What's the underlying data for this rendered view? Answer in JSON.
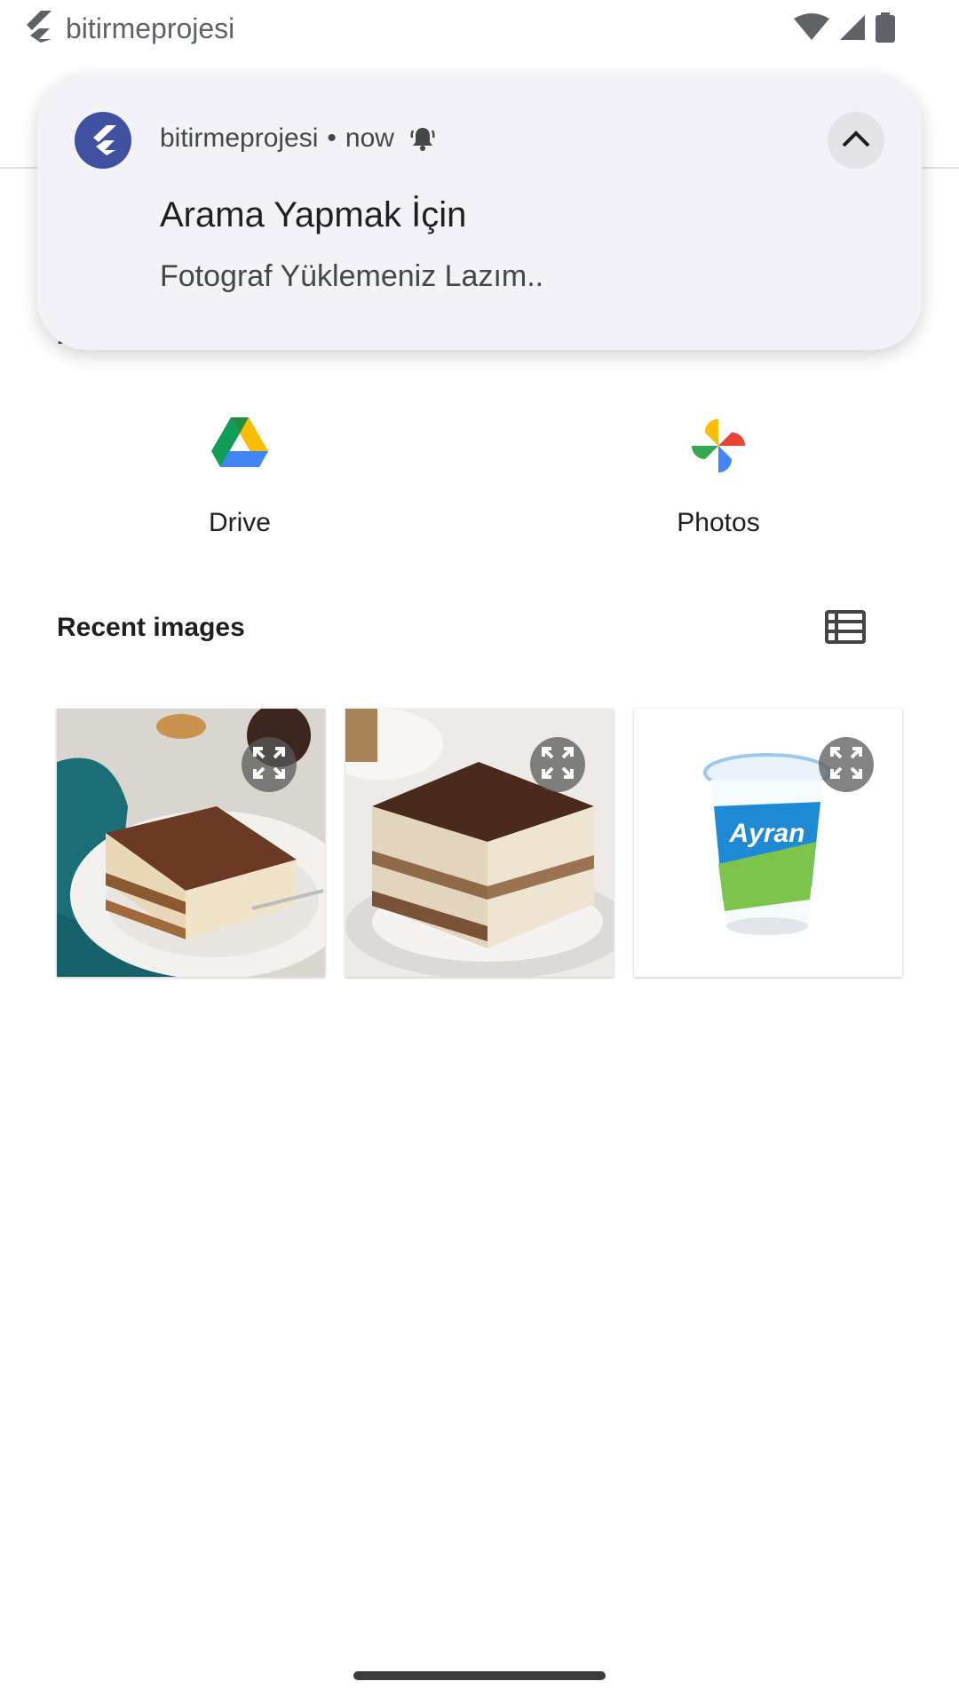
{
  "status_bar": {
    "app_name": "bitirmeprojesi"
  },
  "notification": {
    "app_name": "bitirmeprojesi",
    "separator": "•",
    "time": "now",
    "title": "Arama Yapmak İçin",
    "body": "Fotograf Yüklemeniz Lazım.."
  },
  "partial_heading": "B",
  "providers": [
    {
      "label": "Drive",
      "icon": "google-drive-icon"
    },
    {
      "label": "Photos",
      "icon": "google-photos-icon"
    }
  ],
  "recent": {
    "title": "Recent images",
    "images": [
      {
        "name": "tiramisu-photo-1"
      },
      {
        "name": "tiramisu-photo-2"
      },
      {
        "name": "ayran-cup-photo",
        "brand_text": "Ayran"
      }
    ]
  },
  "colors": {
    "accent": "#3f51a0",
    "notification_bg": "#f2f2f8"
  }
}
